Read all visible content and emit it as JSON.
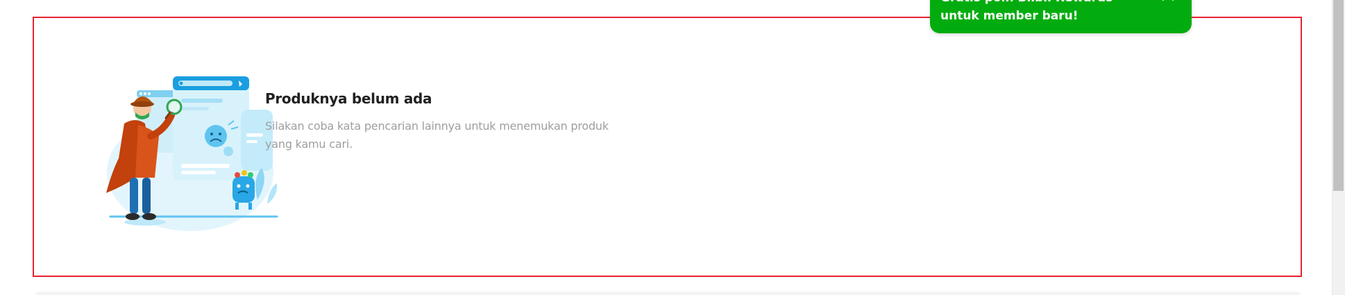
{
  "empty_state": {
    "title": "Produknya belum ada",
    "description": "Silakan coba kata pencarian lainnya untuk menemukan produk yang kamu cari.",
    "illustration_icon": "detective-search-illustration"
  },
  "toast": {
    "message": "Gratis poin Blibli Rewards untuk member baru!",
    "close_icon": "close-icon",
    "background_color": "#03ac0e"
  },
  "colors": {
    "highlight_border": "#e8232f",
    "title": "#212121",
    "description": "#9e9e9e"
  }
}
